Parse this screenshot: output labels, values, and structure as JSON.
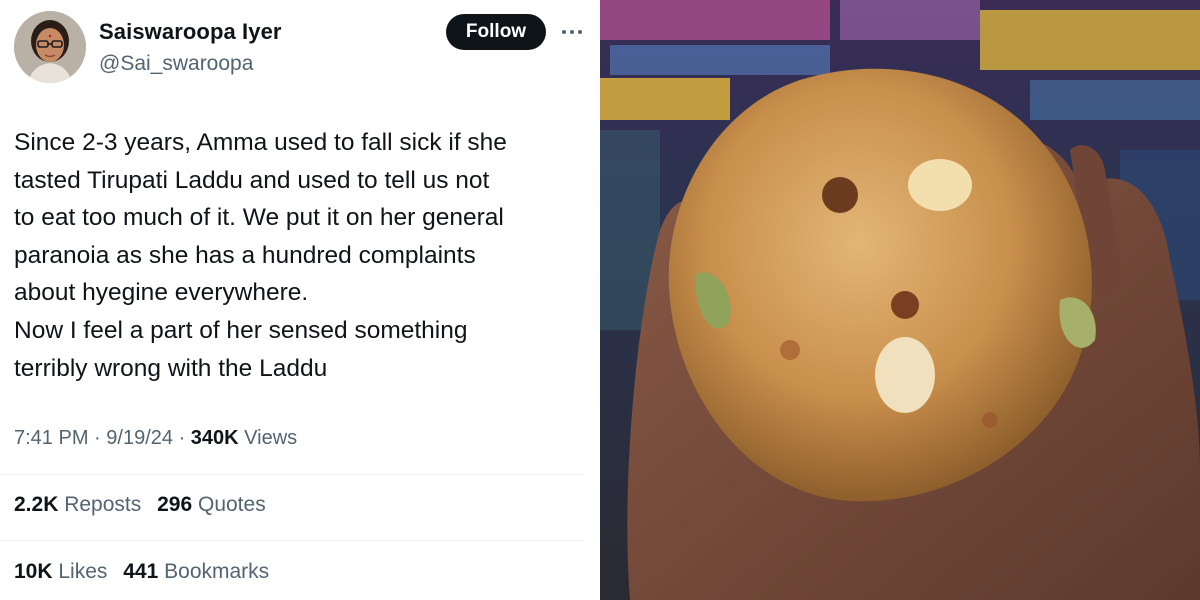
{
  "author": {
    "name": "Saiswaroopa Iyer",
    "handle": "@Sai_swaroopa"
  },
  "follow_label": "Follow",
  "tweet_lines": [
    "Since 2-3 years, Amma used to fall sick if she",
    "tasted Tirupati Laddu and used to tell us not",
    "to eat too much of it. We put it on her general",
    "paranoia as she has a hundred complaints",
    "about hyegine everywhere.",
    "Now I feel a part of her sensed something",
    "terribly wrong with the Laddu"
  ],
  "meta": {
    "time": "7:41 PM",
    "date": "9/19/24",
    "views_count": "340K",
    "views_label": "Views"
  },
  "stats": {
    "reposts_count": "2.2K",
    "reposts_label": "Reposts",
    "quotes_count": "296",
    "quotes_label": "Quotes",
    "likes_count": "10K",
    "likes_label": "Likes",
    "bookmarks_count": "441",
    "bookmarks_label": "Bookmarks"
  },
  "colors": {
    "text_primary": "#0f1419",
    "text_secondary": "#536471",
    "follow_bg": "#0f1419",
    "divider": "#eff3f4"
  },
  "photo": {
    "subject": "laddu-in-hand-photo"
  }
}
